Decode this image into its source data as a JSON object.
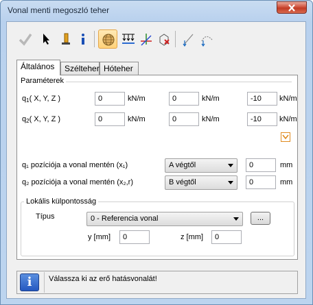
{
  "window": {
    "title": "Vonal menti megoszló teher"
  },
  "toolbar": {
    "buttons": [
      {
        "name": "ok-check-icon",
        "active": false
      },
      {
        "name": "select-pointer-icon",
        "active": false
      },
      {
        "name": "property-pen-icon",
        "active": false
      },
      {
        "name": "info-i-icon",
        "active": false
      },
      {
        "name": "sphere-view-icon",
        "active": true
      },
      {
        "name": "distributed-load-icon",
        "active": false
      },
      {
        "name": "local-axes-icon",
        "active": false
      },
      {
        "name": "element-delete-icon",
        "active": false
      },
      {
        "name": "line-load-icon",
        "active": false
      },
      {
        "name": "arc-load-icon",
        "active": false
      }
    ]
  },
  "tabs": [
    {
      "label": "Általános",
      "active": true
    },
    {
      "label": "Szélteher",
      "active": false
    },
    {
      "label": "Hóteher",
      "active": false
    }
  ],
  "params": {
    "group_label": "Paraméterek",
    "q1": {
      "label_prefix": "q",
      "label_sub": "1",
      "label_suffix": "( X, Y, Z )",
      "x": "0",
      "y": "0",
      "z": "-10"
    },
    "q2": {
      "label_prefix": "q",
      "label_sub": "2",
      "label_suffix": "( X, Y, Z )",
      "x": "0",
      "y": "0",
      "z": "-10"
    },
    "unit": "kN/m"
  },
  "position": {
    "q1": {
      "label": "q₁ pozíciója a vonal mentén (x₁)",
      "select": "A végtől",
      "value": "0",
      "unit": "mm"
    },
    "q2": {
      "label": "q₂ pozíciója a vonal mentén (x₂,r)",
      "select": "B végtől",
      "value": "0",
      "unit": "mm"
    }
  },
  "local": {
    "group_label": "Lokális külpontosság",
    "type_label": "Típus",
    "type_value": "0 - Referencia vonal",
    "dots_label": "...",
    "y_label": "y [mm]",
    "y_value": "0",
    "z_label": "z [mm]",
    "z_value": "0"
  },
  "status": {
    "message": "Válassza ki az erő hatásvonalát!"
  },
  "colors": {
    "accent_orange": "#e08a1e",
    "title_bar": "#bcd4ef",
    "close_red": "#c13b25"
  }
}
